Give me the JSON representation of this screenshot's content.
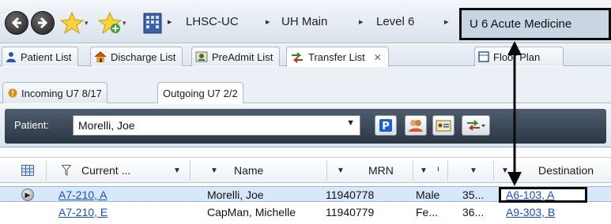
{
  "navbar": {
    "breadcrumbs": [
      "LHSC-UC",
      "UH Main",
      "Level 6"
    ],
    "current": "U 6 Acute Medicine"
  },
  "tabs": [
    {
      "label": "Patient List",
      "icon": "person-icon"
    },
    {
      "label": "Discharge List",
      "icon": "home-icon"
    },
    {
      "label": "PreAdmit List",
      "icon": "preadmit-icon"
    },
    {
      "label": "Transfer List",
      "icon": "transfer-icon",
      "close": "✕"
    },
    {
      "label": "Floor Plan",
      "icon": "floorplan-icon"
    }
  ],
  "subtabs": [
    {
      "label": "Incoming U7 8/17",
      "icon": "warning-icon"
    },
    {
      "label": "Outgoing U7 2/2"
    }
  ],
  "patient_bar": {
    "label": "Patient:",
    "selected": "Morelli, Joe"
  },
  "grid": {
    "columns": [
      "Current ...",
      "Name",
      "MRN",
      "Destination"
    ],
    "rows": [
      {
        "current": "A7-210, A",
        "name": "Morelli, Joe",
        "mrn": "11940778",
        "sex": "Male",
        "age": "35...",
        "destination": "A6-103, A"
      },
      {
        "current": "A7-210, E",
        "name": "CapMan, Michelle",
        "mrn": "11940779",
        "sex": "Fe...",
        "age": "36...",
        "destination": "A9-303, B"
      }
    ]
  },
  "colors": {
    "nav_bg": "#dbe3ec",
    "toolbar_dark": "#2b3644",
    "link": "#1a4fc0",
    "selected_row": "#d6e8fa",
    "annotation": "#0a0a0a"
  }
}
